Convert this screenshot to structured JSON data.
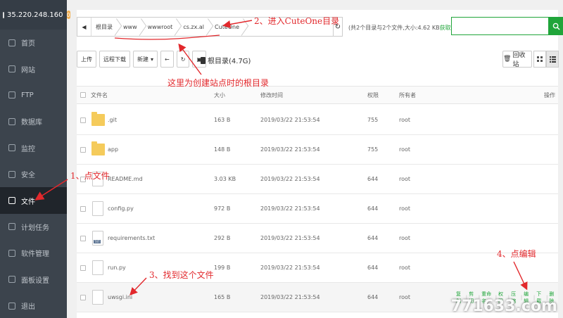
{
  "sidebar": {
    "ip": "35.220.248.160",
    "badge": "0",
    "items": [
      {
        "label": "首页"
      },
      {
        "label": "网站"
      },
      {
        "label": "FTP"
      },
      {
        "label": "数据库"
      },
      {
        "label": "监控"
      },
      {
        "label": "安全"
      },
      {
        "label": "文件",
        "active": true
      },
      {
        "label": "计划任务"
      },
      {
        "label": "软件管理"
      },
      {
        "label": "面板设置"
      },
      {
        "label": "退出"
      }
    ]
  },
  "path": {
    "crumbs": [
      "根目录",
      "www",
      "wwwroot",
      "cs.zx.al",
      "CuteOne"
    ],
    "info_text": "(共2个目录与2个文件,大小:4.62 KB",
    "info_link": "获取",
    "info_end": ")"
  },
  "toolbar": {
    "upload": "上传",
    "remote_download": "远程下载",
    "new": "新建",
    "disk_label": "根目录(4.7G)",
    "recycle": "回收站"
  },
  "table": {
    "headers": {
      "name": "文件名",
      "size": "大小",
      "mtime": "修改时间",
      "perm": "权限",
      "owner": "所有者",
      "ops": "操作"
    },
    "rows": [
      {
        "name": ".git",
        "size": "163 B",
        "mtime": "2019/03/22 21:53:54",
        "perm": "755",
        "owner": "root",
        "type": "folder"
      },
      {
        "name": "app",
        "size": "148 B",
        "mtime": "2019/03/22 21:53:54",
        "perm": "755",
        "owner": "root",
        "type": "folder"
      },
      {
        "name": "README.md",
        "size": "3.03 KB",
        "mtime": "2019/03/22 21:53:54",
        "perm": "644",
        "owner": "root",
        "type": "file"
      },
      {
        "name": "config.py",
        "size": "972 B",
        "mtime": "2019/03/22 21:53:54",
        "perm": "644",
        "owner": "root",
        "type": "file"
      },
      {
        "name": "requirements.txt",
        "size": "292 B",
        "mtime": "2019/03/22 21:53:54",
        "perm": "644",
        "owner": "root",
        "type": "txt"
      },
      {
        "name": "run.py",
        "size": "199 B",
        "mtime": "2019/03/22 21:53:54",
        "perm": "644",
        "owner": "root",
        "type": "file"
      },
      {
        "name": "uwsgi.ini",
        "size": "165 B",
        "mtime": "2019/03/22 21:53:54",
        "perm": "644",
        "owner": "root",
        "type": "file"
      }
    ],
    "row_ops": [
      "复制",
      "剪切",
      "重命名",
      "权限",
      "压缩",
      "编辑",
      "下载",
      "删除"
    ]
  },
  "annotations": {
    "step1": "1、点文件",
    "step2": "2、进入CuteOne目录",
    "step3": "3、找到这个文件",
    "step4": "4、点编辑",
    "root_note": "这里为创建站点时的根目录"
  },
  "watermark": "771633.com",
  "colors": {
    "accent": "#20a53a",
    "sidebar": "#3c444d",
    "annotation": "#e2282c"
  }
}
